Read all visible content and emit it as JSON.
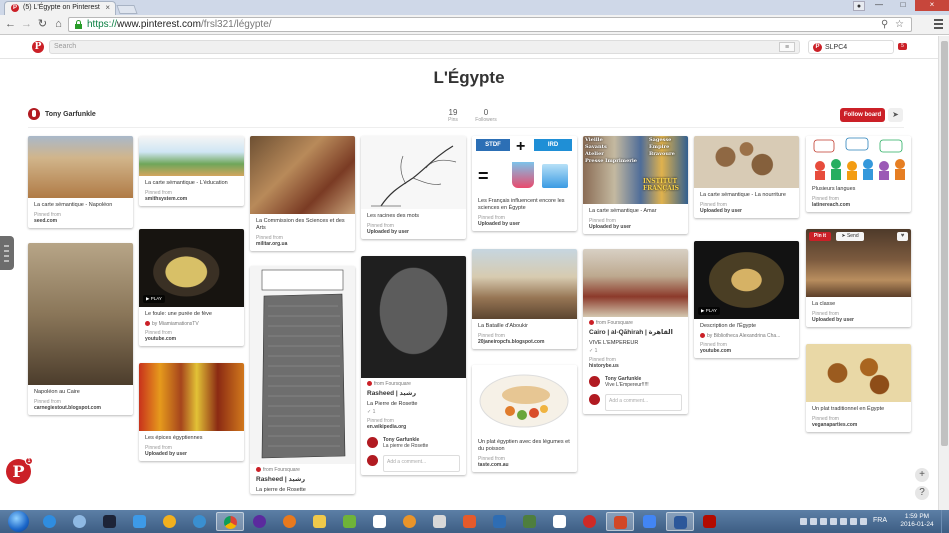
{
  "browser": {
    "tab_title": "(5) L'Égypte on Pinterest",
    "tab_close": "×",
    "url_scheme": "https://",
    "url_host": "www.pinterest.com",
    "url_path": "/frsl321/légypte/",
    "window_min": "—",
    "window_max": "□",
    "window_close": "×",
    "back": "←",
    "forward": "→",
    "reload": "↻",
    "home": "⌂",
    "zoom_icon": "⚲",
    "star_icon": "☆"
  },
  "pinterest": {
    "logo": "P",
    "search_placeholder": "Search",
    "search_list_icon": "≡",
    "user_name": "SLPC4",
    "user_initial": "P",
    "notification_count": "5"
  },
  "board": {
    "title": "L'Égypte",
    "owner": "Tony Garfunkle",
    "pins_count": "19",
    "pins_label": "Pins",
    "followers_count": "0",
    "followers_label": "Followers",
    "follow_label": "Follow board",
    "send_icon": "➤"
  },
  "pins": [
    {
      "id": "p1",
      "desc": "La carte sémantique - Napoléon",
      "pinned_from": "Pinned from",
      "source": "seed.com"
    },
    {
      "id": "p2",
      "desc": "Napoléon au Caire",
      "pinned_from": "Pinned from",
      "source": "carnegiestout.blogspot.com"
    },
    {
      "id": "p3",
      "desc": "La carte sémantique - L'éducation",
      "pinned_from": "Pinned from",
      "source": "smithsystem.com"
    },
    {
      "id": "p4",
      "desc": "Le foule: une purée de fève",
      "video_by": "by MiamiamationsTV",
      "pinned_from": "Pinned from",
      "source": "youtube.com",
      "play": "▶ PLAY"
    },
    {
      "id": "p5",
      "desc": "Les épices égyptiennes",
      "pinned_from": "Pinned from",
      "source": "Uploaded by user"
    },
    {
      "id": "p6",
      "desc": "La Commission des Sciences et des Arts",
      "pinned_from": "Pinned from",
      "source": "militar.org.ua"
    },
    {
      "id": "p7",
      "from": "from Foursquare",
      "place": "Rasheed | رشيد",
      "desc": "La pierre de Rosette"
    },
    {
      "id": "p8",
      "desc": "Les racines des mots",
      "pinned_from": "Pinned from",
      "source": "Uploaded by user"
    },
    {
      "id": "p9",
      "from": "from Foursquare",
      "place": "Rasheed | رشيد",
      "desc": "La Pierre de Rosette",
      "checkins": "✓ 1",
      "pinned_from": "Pinned from",
      "source": "en.wikipedia.org",
      "commenter": "Tony Garfunkle",
      "comment": "La pierre de Rosette",
      "comment_placeholder": "Add a comment..."
    },
    {
      "id": "p10",
      "desc": "Les Français influencent encore les sciences en Égypte",
      "pinned_from": "Pinned from",
      "source": "Uploaded by user",
      "logo_left": "STDF",
      "logo_right": "IRD"
    },
    {
      "id": "p11",
      "desc": "La Bataille d'Aboukir",
      "pinned_from": "Pinned from",
      "source": "20janeiropcfs.blogspot.com"
    },
    {
      "id": "p12",
      "desc": "Un plat égyptien avec des légumes et du poisson",
      "pinned_from": "Pinned from",
      "source": "taste.com.au"
    },
    {
      "id": "p13",
      "desc": "La carte sémantique - Amar",
      "pinned_from": "Pinned from",
      "source": "Uploaded by user",
      "img_words": [
        "Vieille",
        "Savants",
        "Atelier",
        "Presse Imprimerie",
        "Sagesse",
        "Empire",
        "Bravoure",
        "INSTITUT FRANÇAIS"
      ]
    },
    {
      "id": "p14",
      "from": "from Foursquare",
      "place": "Cairo | al-Qāhirah | القاهرة",
      "desc": "VIVE L'EMPEREUR",
      "checkins": "✓ 1",
      "pinned_from": "Pinned from",
      "source": "historybe.us",
      "commenter": "Tony Garfunkle",
      "comment": "Vive L'Empereur!!!!!",
      "comment_placeholder": "Add a comment..."
    },
    {
      "id": "p15",
      "desc": "La carte sémantique - La nourriture",
      "pinned_from": "Pinned from",
      "source": "Uploaded by user"
    },
    {
      "id": "p16",
      "desc": "Description de l'Égypte",
      "video_by": "by Bibliotheca Alexandrina Cha...",
      "pinned_from": "Pinned from",
      "source": "youtube.com",
      "play": "▶ PLAY"
    },
    {
      "id": "p17",
      "desc": "Plusieurs langues",
      "pinned_from": "Pinned from",
      "source": "latinereach.com"
    },
    {
      "id": "p18",
      "desc": "La classe",
      "pinned_from": "Pinned from",
      "source": "Uploaded by user",
      "pin_it": "Pin it",
      "send": "➤ Send",
      "heart": "♥"
    },
    {
      "id": "p19",
      "desc": "Un plat traditionnel en Égypte",
      "pinned_from": "Pinned from",
      "source": "veganaparties.com"
    }
  ],
  "page_tools": {
    "pin_fab": "P",
    "pin_fab_badge": "1",
    "add": "+",
    "help": "?"
  },
  "taskbar": {
    "language": "FRA",
    "time": "1:59 PM",
    "date": "2016-01-24"
  }
}
